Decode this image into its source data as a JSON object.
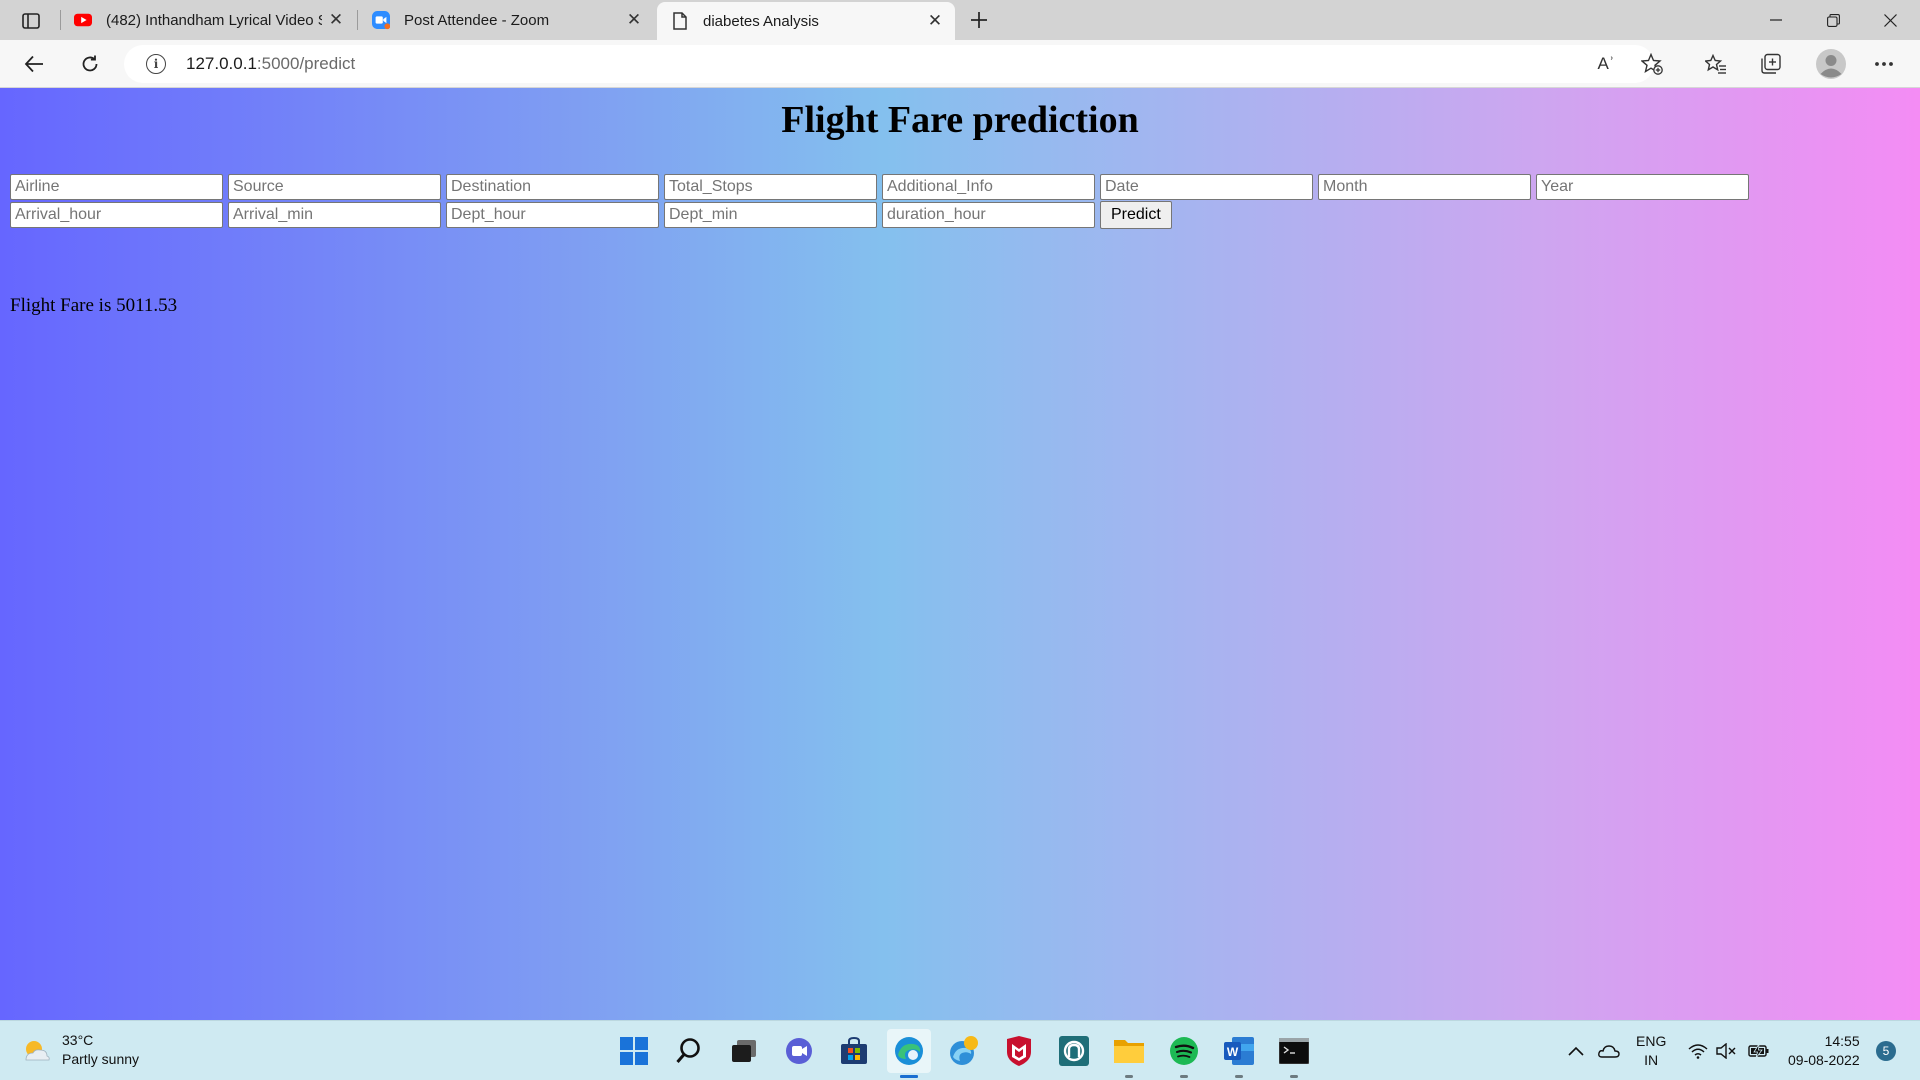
{
  "browser": {
    "tabs": [
      {
        "title": "(482) Inthandham Lyrical Video S",
        "favicon": "youtube-icon",
        "active": false
      },
      {
        "title": "Post Attendee - Zoom",
        "favicon": "zoom-icon",
        "active": false
      },
      {
        "title": "diabetes Analysis",
        "favicon": "page-icon",
        "active": true
      }
    ],
    "url_host": "127.0.0.1",
    "url_path": ":5000/predict",
    "read_aloud_label": "Aʾ"
  },
  "page": {
    "heading": "Flight Fare prediction",
    "row1_placeholders": [
      "Airline",
      "Source",
      "Destination",
      "Total_Stops",
      "Additional_Info",
      "Date",
      "Month",
      "Year"
    ],
    "row2_placeholders": [
      "Arrival_hour",
      "Arrival_min",
      "Dept_hour",
      "Dept_min",
      "duration_hour"
    ],
    "predict_label": "Predict",
    "result_text": "Flight Fare is 5011.53",
    "gradient_colors": [
      "#6666ff",
      "#84c0ee",
      "#f48cf4"
    ]
  },
  "taskbar": {
    "weather_temp": "33°C",
    "weather_desc": "Partly sunny",
    "lang_line1": "ENG",
    "lang_line2": "IN",
    "time": "14:55",
    "date": "09-08-2022",
    "notification_count": "5",
    "apps": [
      "start-icon",
      "search-icon",
      "task-view-icon",
      "teams-chat-icon",
      "microsoft-store-icon",
      "edge-icon",
      "edge-beta-icon",
      "mcafee-icon",
      "app-icon",
      "file-explorer-icon",
      "spotify-icon",
      "word-icon",
      "terminal-icon"
    ]
  }
}
